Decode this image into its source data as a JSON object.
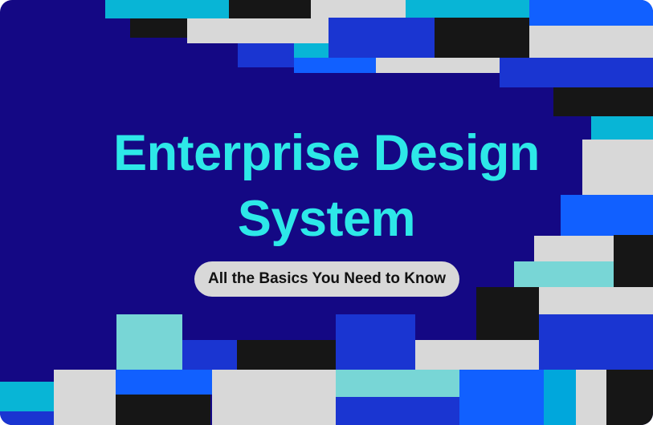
{
  "banner": {
    "title_line1": "Enterprise Design",
    "title_line2": "System",
    "subtitle": "All the Basics You Need to Know"
  },
  "palette": {
    "background": "#140884",
    "title_color": "#2de8e8",
    "pill_background": "#d8d8d8",
    "pill_text": "#111111",
    "cyan": "#08b5d6",
    "black": "#161616",
    "gray": "#d8d8d8",
    "royal_blue": "#1a35d1",
    "bright_blue": "#1160ff",
    "teal": "#78d6d6",
    "sky": "#00a7dc"
  }
}
